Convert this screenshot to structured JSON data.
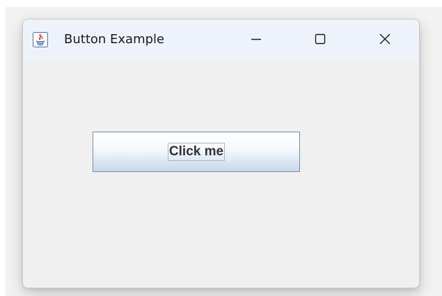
{
  "window": {
    "title": "Button Example",
    "app_icon": "java-icon",
    "controls": {
      "minimize_icon": "minimize-icon",
      "maximize_icon": "maximize-icon",
      "close_icon": "close-icon"
    }
  },
  "content": {
    "button_label": "Click me"
  },
  "colors": {
    "titlebar": "#eef3fb",
    "content_bg": "#f0f0f0",
    "button_border": "#7a8aa0",
    "button_text": "#333333"
  }
}
